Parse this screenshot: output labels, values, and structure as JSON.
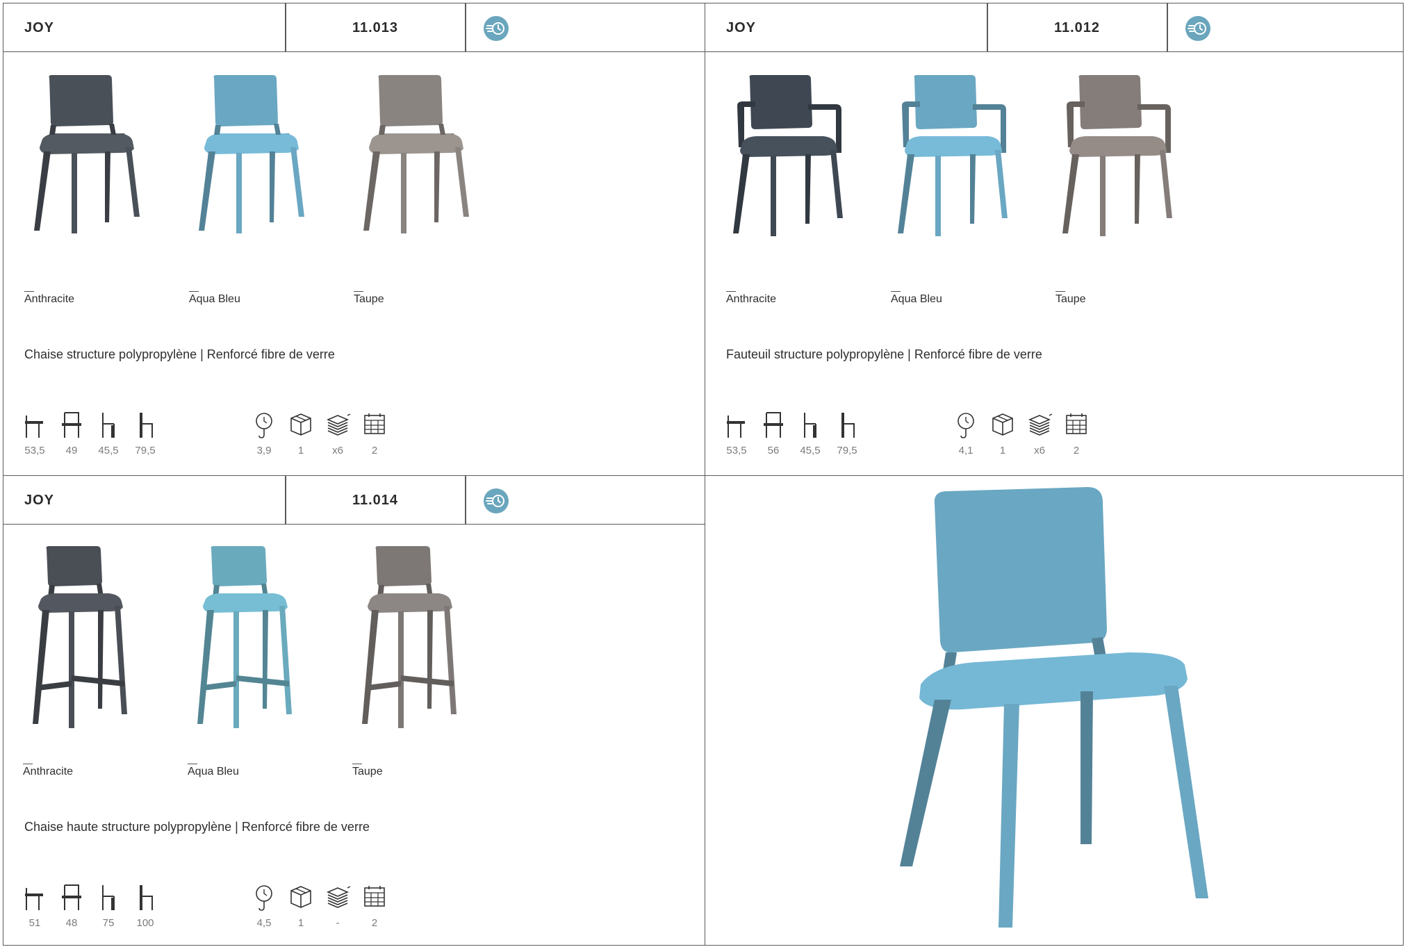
{
  "panels": [
    {
      "name": "JOY",
      "ref": "11.013",
      "badge_icon": "delivery-clock-icon",
      "badge_color": "#6aa6bd",
      "variants": [
        {
          "dash": "—",
          "label": "Anthracite",
          "color": "#4a5057"
        },
        {
          "dash": "—",
          "label": "Aqua Bleu",
          "color": "#6aa7c2"
        },
        {
          "dash": "—",
          "label": "Taupe",
          "color": "#8a8480"
        }
      ],
      "description": "Chaise structure polypropylène | Renforcé fibre de verre",
      "dims": [
        {
          "icon": "seat-depth-icon",
          "value": "53,5"
        },
        {
          "icon": "seat-width-icon",
          "value": "49"
        },
        {
          "icon": "seat-height-icon",
          "value": "45,5"
        },
        {
          "icon": "total-height-icon",
          "value": "79,5"
        }
      ],
      "logistics": [
        {
          "icon": "weight-icon",
          "value": "3,9"
        },
        {
          "icon": "box-icon",
          "value": "1"
        },
        {
          "icon": "stack-icon",
          "value": "x6"
        },
        {
          "icon": "calendar-icon",
          "value": "2"
        }
      ]
    },
    {
      "name": "JOY",
      "ref": "11.012",
      "badge_icon": "delivery-clock-icon",
      "badge_color": "#6aa6bd",
      "variants": [
        {
          "dash": "—",
          "label": "Anthracite",
          "color": "#3f4852"
        },
        {
          "dash": "—",
          "label": "Aqua Bleu",
          "color": "#6aa7c2"
        },
        {
          "dash": "—",
          "label": "Taupe",
          "color": "#857d79"
        }
      ],
      "description": "Fauteuil structure polypropylène | Renforcé fibre de verre",
      "dims": [
        {
          "icon": "seat-depth-icon",
          "value": "53,5"
        },
        {
          "icon": "seat-width-icon",
          "value": "56"
        },
        {
          "icon": "seat-height-icon",
          "value": "45,5"
        },
        {
          "icon": "total-height-icon",
          "value": "79,5"
        }
      ],
      "logistics": [
        {
          "icon": "weight-icon",
          "value": "4,1"
        },
        {
          "icon": "box-icon",
          "value": "1"
        },
        {
          "icon": "stack-icon",
          "value": "x6"
        },
        {
          "icon": "calendar-icon",
          "value": "2"
        }
      ]
    },
    {
      "name": "JOY",
      "ref": "11.014",
      "badge_icon": "delivery-clock-icon",
      "badge_color": "#6aa6bd",
      "variants": [
        {
          "dash": "—",
          "label": "Anthracite",
          "color": "#4a4e55"
        },
        {
          "dash": "—",
          "label": "Aqua Bleu",
          "color": "#6aaabd"
        },
        {
          "dash": "—",
          "label": "Taupe",
          "color": "#7d7876"
        }
      ],
      "description": "Chaise haute structure polypropylène | Renforcé fibre de verre",
      "dims": [
        {
          "icon": "seat-depth-icon",
          "value": "51"
        },
        {
          "icon": "seat-width-icon",
          "value": "48"
        },
        {
          "icon": "seat-height-icon",
          "value": "75"
        },
        {
          "icon": "total-height-icon",
          "value": "100"
        }
      ],
      "logistics": [
        {
          "icon": "weight-icon",
          "value": "4,5"
        },
        {
          "icon": "box-icon",
          "value": "1"
        },
        {
          "icon": "stack-icon",
          "value": "-"
        },
        {
          "icon": "calendar-icon",
          "value": "2"
        }
      ]
    }
  ],
  "hero": {
    "icon": "chair-photo-aqua",
    "color": "#6aa7c2"
  }
}
